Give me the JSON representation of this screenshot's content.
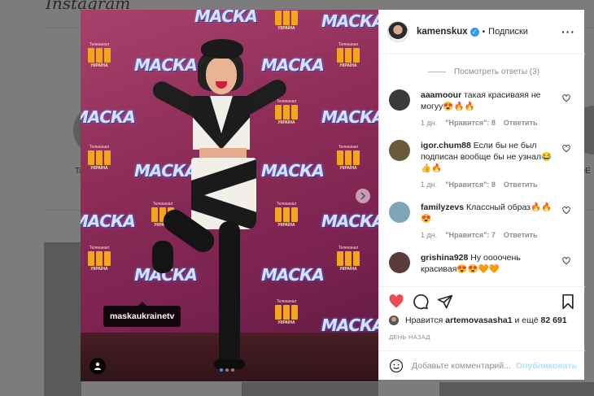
{
  "background": {
    "logo": "Instagram",
    "left_label": "Ta",
    "right_label": "DE"
  },
  "photo": {
    "wall_logo": "МАСКА",
    "wall_tv_top": "Телеканал",
    "wall_tv_caption": "УКРАЇНА",
    "tag_label": "maskaukrainetv",
    "next_icon": "chevron-right-icon",
    "user_tag_icon": "user-icon"
  },
  "header": {
    "username": "kamenskux",
    "dot": "•",
    "follow_label": "Подписки",
    "more_label": "···"
  },
  "comments": {
    "view_replies": "Посмотреть ответы (3)",
    "items": [
      {
        "username": "aaamoour",
        "text": "такая красиваяя не могуу😍🔥🔥",
        "age": "1 дн.",
        "likes": "\"Нравится\": 8",
        "reply": "Ответить",
        "avatar_color": "#3a3a3a"
      },
      {
        "username": "igor.chum88",
        "text": "Если бы не был подписан вообще бы не узнал😂👍🔥",
        "age": "1 дн.",
        "likes": "\"Нравится\": 8",
        "reply": "Ответить",
        "avatar_color": "#6b5a3a"
      },
      {
        "username": "familyzevs",
        "text": "Классный образ🔥🔥😍",
        "age": "1 дн.",
        "likes": "\"Нравится\": 7",
        "reply": "Ответить",
        "avatar_color": "#7fa6b8"
      },
      {
        "username": "grishina928",
        "text": "Ну оооочень красивая😍😍🧡🧡",
        "age": "",
        "likes": "",
        "reply": "",
        "avatar_color": "#5a3a3a"
      }
    ]
  },
  "likes": {
    "prefix": "Нравится",
    "user": "artemovasasha1",
    "suffix": "и ещё",
    "count": "82 691"
  },
  "time": "ДЕНЬ НАЗАД",
  "add_comment": {
    "placeholder": "Добавьте комментарий...",
    "publish_label": "Опубликовать"
  },
  "colors": {
    "liked": "#ed4956",
    "verified": "#3897f0",
    "publish_disabled": "#b2dffc"
  }
}
